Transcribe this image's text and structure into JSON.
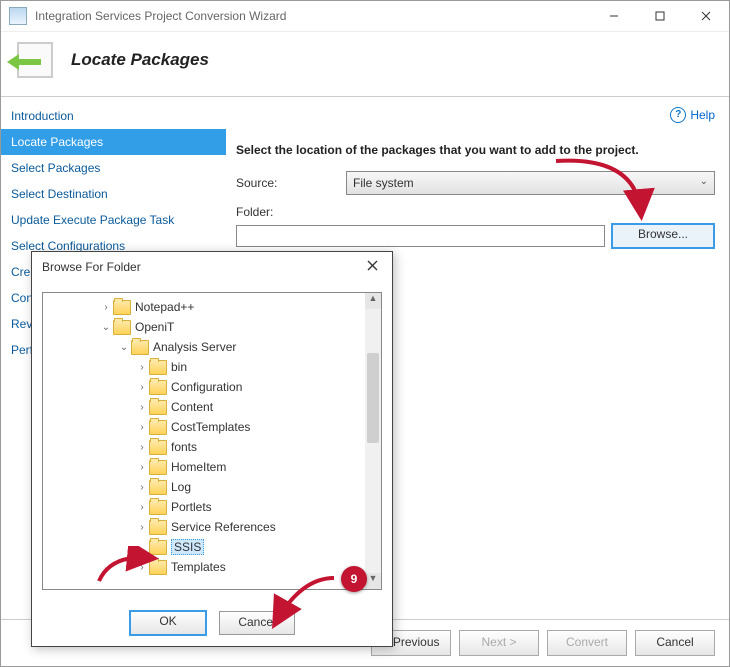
{
  "window": {
    "title": "Integration Services Project Conversion Wizard",
    "heading": "Locate Packages"
  },
  "nav": {
    "items": [
      "Introduction",
      "Locate Packages",
      "Select Packages",
      "Select Destination",
      "Update Execute Package Task",
      "Select Configurations",
      "Create Parameters",
      "Configure Parameters",
      "Review",
      "Perform Conversion"
    ],
    "active_index": 1
  },
  "help": {
    "label": "Help"
  },
  "form": {
    "instruction": "Select the location of the packages that you want to add to the project.",
    "source_label": "Source:",
    "source_value": "File system",
    "folder_label": "Folder:",
    "folder_value": "",
    "browse_label": "Browse..."
  },
  "footer": {
    "previous": "< Previous",
    "next": "Next >",
    "convert": "Convert",
    "cancel": "Cancel"
  },
  "dialog": {
    "title": "Browse For Folder",
    "tree": [
      {
        "depth": 2,
        "expand": "closed",
        "label": "Notepad++"
      },
      {
        "depth": 2,
        "expand": "open",
        "label": "OpeniT"
      },
      {
        "depth": 3,
        "expand": "open",
        "label": "Analysis Server"
      },
      {
        "depth": 4,
        "expand": "closed",
        "label": "bin"
      },
      {
        "depth": 4,
        "expand": "closed",
        "label": "Configuration"
      },
      {
        "depth": 4,
        "expand": "closed",
        "label": "Content"
      },
      {
        "depth": 4,
        "expand": "closed",
        "label": "CostTemplates"
      },
      {
        "depth": 4,
        "expand": "closed",
        "label": "fonts"
      },
      {
        "depth": 4,
        "expand": "closed",
        "label": "HomeItem"
      },
      {
        "depth": 4,
        "expand": "closed",
        "label": "Log"
      },
      {
        "depth": 4,
        "expand": "closed",
        "label": "Portlets"
      },
      {
        "depth": 4,
        "expand": "closed",
        "label": "Service References"
      },
      {
        "depth": 4,
        "expand": "none",
        "label": "SSIS",
        "selected": true
      },
      {
        "depth": 4,
        "expand": "closed",
        "label": "Templates"
      }
    ],
    "ok": "OK",
    "cancel": "Cancel"
  },
  "annotation": {
    "badge": "9"
  }
}
